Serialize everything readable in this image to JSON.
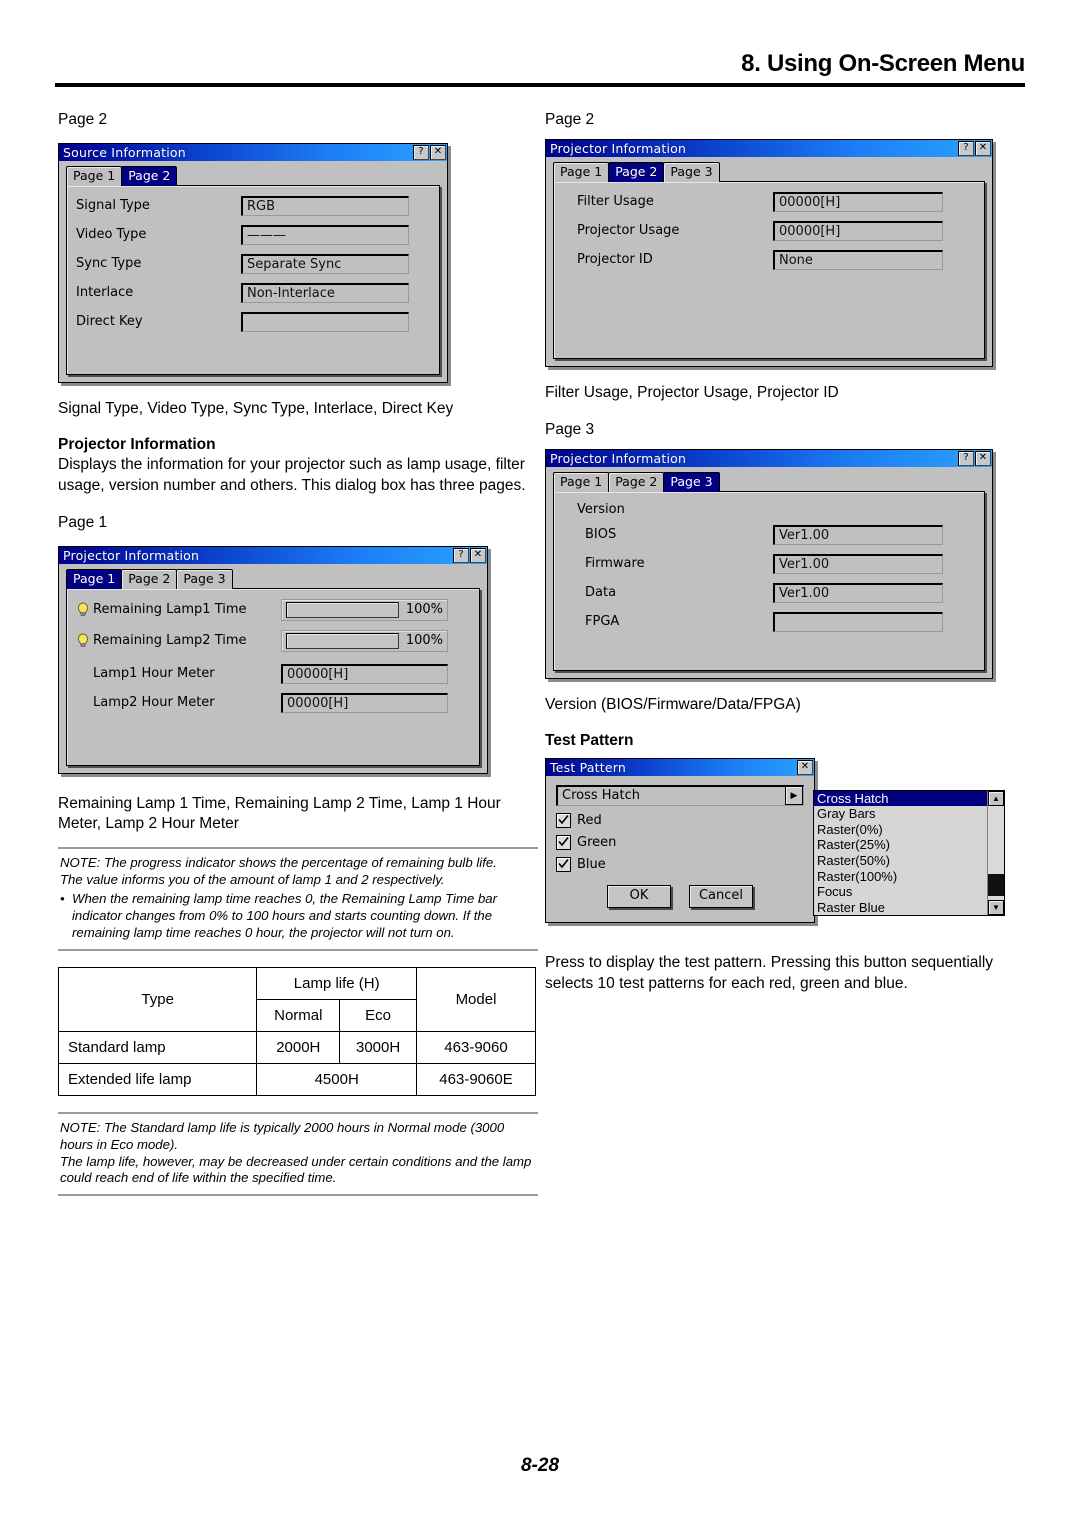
{
  "header": {
    "title": "8. Using On-Screen Menu"
  },
  "left": {
    "page_label_2": "Page 2",
    "source_info_dialog": {
      "title": "Source Information",
      "help_btn": "?",
      "close_btn": "✕",
      "tabs": [
        {
          "label": "Page 1",
          "active": false
        },
        {
          "label": "Page 2",
          "active": true
        }
      ],
      "rows": [
        {
          "label": "Signal Type",
          "value": "RGB"
        },
        {
          "label": "Video Type",
          "value": "———"
        },
        {
          "label": "Sync Type",
          "value": "Separate Sync"
        },
        {
          "label": "Interlace",
          "value": "Non-Interlace"
        },
        {
          "label": "Direct Key",
          "value": ""
        }
      ]
    },
    "caption_source": "Signal Type, Video Type, Sync Type, Interlace, Direct Key",
    "projector_info_heading": "Projector Information",
    "projector_info_body": "Displays the information for your projector such as lamp usage, filter usage, version number and others. This dialog box has three pages.",
    "page_label_1": "Page 1",
    "proj_page1_dialog": {
      "title": "Projector Information",
      "help_btn": "?",
      "close_btn": "✕",
      "tabs": [
        {
          "label": "Page 1",
          "active": true
        },
        {
          "label": "Page 2",
          "active": false
        },
        {
          "label": "Page 3",
          "active": false
        }
      ],
      "progress_rows": [
        {
          "label": "Remaining Lamp1 Time",
          "percent": "100%"
        },
        {
          "label": "Remaining Lamp2 Time",
          "percent": "100%"
        }
      ],
      "rows": [
        {
          "label": "Lamp1 Hour Meter",
          "value": "00000[H]"
        },
        {
          "label": "Lamp2 Hour Meter",
          "value": "00000[H]"
        }
      ]
    },
    "caption_lamp": "Remaining Lamp 1 Time, Remaining Lamp 2 Time, Lamp 1 Hour Meter, Lamp 2 Hour Meter",
    "note_lamp": {
      "line1": "NOTE: The progress indicator shows the percentage of remaining bulb life.",
      "line2": "The value informs you of the amount of lamp 1 and 2 respectively.",
      "bullet_dot": "•",
      "bullet": "When the remaining lamp time reaches 0, the Remaining Lamp Time bar indicator changes from 0% to 100 hours and starts counting down. If the remaining lamp time reaches 0 hour, the projector will not turn on."
    },
    "lamp_table": {
      "h_type": "Type",
      "h_lamp_life": "Lamp life (H)",
      "h_normal": "Normal",
      "h_eco": "Eco",
      "h_model": "Model",
      "rows": [
        {
          "type": "Standard lamp",
          "normal": "2000H",
          "eco": "3000H",
          "model": "463-9060",
          "merged": false
        },
        {
          "type": "Extended life lamp",
          "merged_value": "4500H",
          "model": "463-9060E",
          "merged": true
        }
      ]
    },
    "note_table": {
      "line1": "NOTE: The Standard lamp life is typically 2000 hours in Normal mode (3000 hours in Eco mode).",
      "line2": "The lamp life, however, may be decreased under certain conditions and the lamp could reach end of life within the specified time."
    }
  },
  "right": {
    "page_label_2": "Page 2",
    "proj_page2_dialog": {
      "title": "Projector Information",
      "help_btn": "?",
      "close_btn": "✕",
      "tabs": [
        {
          "label": "Page 1",
          "active": false
        },
        {
          "label": "Page 2",
          "active": true
        },
        {
          "label": "Page 3",
          "active": false
        }
      ],
      "rows": [
        {
          "label": "Filter Usage",
          "value": "00000[H]"
        },
        {
          "label": "Projector Usage",
          "value": "00000[H]"
        },
        {
          "label": "Projector ID",
          "value": "None"
        }
      ]
    },
    "caption_page2": "Filter Usage, Projector Usage, Projector ID",
    "page_label_3": "Page 3",
    "proj_page3_dialog": {
      "title": "Projector Information",
      "help_btn": "?",
      "close_btn": "✕",
      "tabs": [
        {
          "label": "Page 1",
          "active": false
        },
        {
          "label": "Page 2",
          "active": false
        },
        {
          "label": "Page 3",
          "active": true
        }
      ],
      "group_label": "Version",
      "rows": [
        {
          "label": "BIOS",
          "value": "Ver1.00"
        },
        {
          "label": "Firmware",
          "value": "Ver1.00"
        },
        {
          "label": "Data",
          "value": "Ver1.00"
        },
        {
          "label": "FPGA",
          "value": ""
        }
      ]
    },
    "caption_page3": "Version (BIOS/Firmware/Data/FPGA)",
    "test_pattern_heading": "Test Pattern",
    "test_pattern_dialog": {
      "title": "Test Pattern",
      "close_btn": "✕",
      "combo_value": "Cross Hatch",
      "combo_arrow": "▶",
      "checkboxes": [
        {
          "label": "Red",
          "checked": true
        },
        {
          "label": "Green",
          "checked": true
        },
        {
          "label": "Blue",
          "checked": true
        }
      ],
      "ok_label": "OK",
      "cancel_label": "Cancel",
      "list_items": [
        {
          "label": "Cross Hatch",
          "selected": true
        },
        {
          "label": "Gray Bars",
          "selected": false
        },
        {
          "label": "Raster(0%)",
          "selected": false
        },
        {
          "label": "Raster(25%)",
          "selected": false
        },
        {
          "label": "Raster(50%)",
          "selected": false
        },
        {
          "label": "Raster(100%)",
          "selected": false
        },
        {
          "label": "Focus",
          "selected": false
        },
        {
          "label": "Raster Blue",
          "selected": false
        }
      ],
      "scroll_up": "▲",
      "scroll_down": "▼"
    },
    "caption_test_pattern": "Press to display the test pattern. Pressing this button sequentially selects 10 test patterns for each red, green and blue."
  },
  "footer": {
    "page_number": "8-28"
  },
  "colors": {
    "title_bar_dark": "#00008c",
    "title_bar_light": "#2aa3ff",
    "dialog_face": "#c0c0c0",
    "tab_active": "#000080",
    "lamp_icon": "#f5e45c"
  }
}
